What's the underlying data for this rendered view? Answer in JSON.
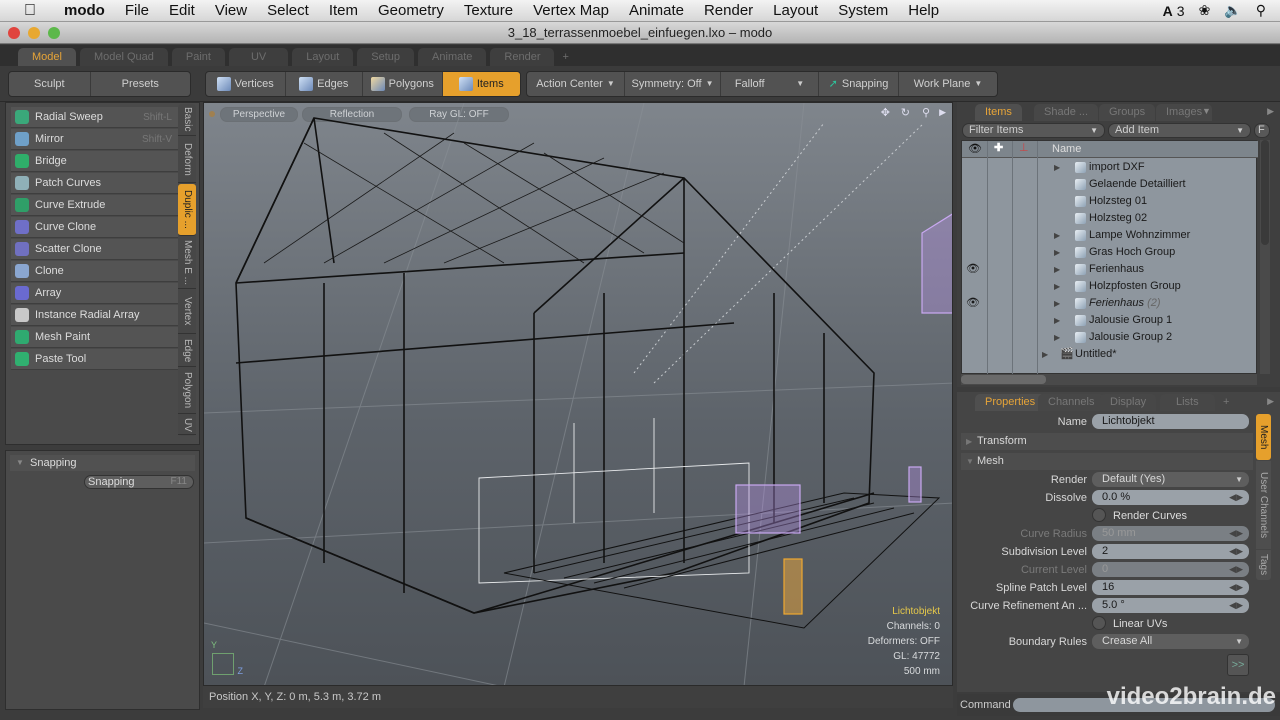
{
  "menubar": {
    "app": "modo",
    "items": [
      "File",
      "Edit",
      "View",
      "Select",
      "Item",
      "Geometry",
      "Texture",
      "Vertex Map",
      "Animate",
      "Render",
      "Layout",
      "System",
      "Help"
    ],
    "status_badge": "3"
  },
  "window": {
    "title": "3_18_terrassenmoebel_einfuegen.lxo – modo"
  },
  "layout_tabs": [
    "Model",
    "Model Quad",
    "Paint",
    "UV",
    "Layout",
    "Setup",
    "Animate",
    "Render",
    "+"
  ],
  "toolbar": {
    "sculpt": "Sculpt",
    "presets": "Presets",
    "modes": [
      "Vertices",
      "Edges",
      "Polygons",
      "Items"
    ],
    "action_center": "Action Center",
    "symmetry": "Symmetry: Off",
    "falloff": "Falloff",
    "snapping": "Snapping",
    "work_plane": "Work Plane"
  },
  "tools": [
    {
      "label": "Radial Sweep",
      "shortcut": "Shift-L",
      "color": "#3aa87a"
    },
    {
      "label": "Mirror",
      "shortcut": "Shift-V",
      "color": "#6fa0c8"
    },
    {
      "label": "Bridge",
      "shortcut": "",
      "color": "#2fae6a"
    },
    {
      "label": "Patch Curves",
      "shortcut": "",
      "color": "#8fb0b8"
    },
    {
      "label": "Curve Extrude",
      "shortcut": "",
      "color": "#2f9f68"
    },
    {
      "label": "Curve Clone",
      "shortcut": "",
      "color": "#6f6fc8"
    },
    {
      "label": "Scatter Clone",
      "shortcut": "",
      "color": "#7070c0"
    },
    {
      "label": "Clone",
      "shortcut": "",
      "color": "#8aa6d0"
    },
    {
      "label": "Array",
      "shortcut": "",
      "color": "#6a6ad0"
    },
    {
      "label": "Instance Radial Array",
      "shortcut": "",
      "color": "#c8c8c8"
    },
    {
      "label": "Mesh Paint",
      "shortcut": "",
      "color": "#2faa70"
    },
    {
      "label": "Paste Tool",
      "shortcut": "",
      "color": "#30b070"
    }
  ],
  "tool_tabs": [
    "Basic",
    "Deform",
    "Duplic ...",
    "Mesh E ...",
    "Vertex",
    "Edge",
    "Polygon",
    "UV"
  ],
  "snapping_panel": {
    "header": "Snapping",
    "button": "Snapping",
    "shortcut": "F11"
  },
  "viewport": {
    "buttons": [
      "Perspective",
      "Reflection",
      "Ray GL: OFF"
    ],
    "info": {
      "selected": "Lichtobjekt",
      "channels": "Channels: 0",
      "deformers": "Deformers: OFF",
      "gl": "GL: 47772",
      "scale": "500 mm"
    },
    "axis": {
      "y": "Y",
      "z": "Z"
    }
  },
  "status": {
    "position": "Position X, Y, Z:   0 m, 5.3 m, 3.72 m"
  },
  "items_panel": {
    "tabs": [
      "Items",
      "Shade ...",
      "Groups",
      "Images"
    ],
    "filter": "Filter Items",
    "add_item": "Add Item",
    "f_button": "F",
    "name_header": "Name",
    "rows": [
      {
        "label": "import DXF",
        "arrow": true,
        "eye": false,
        "italic": false
      },
      {
        "label": "Gelaende Detailliert",
        "arrow": false,
        "eye": false,
        "italic": false
      },
      {
        "label": "Holzsteg 01",
        "arrow": false,
        "eye": false,
        "italic": false
      },
      {
        "label": "Holzsteg 02",
        "arrow": false,
        "eye": false,
        "italic": false
      },
      {
        "label": "Lampe Wohnzimmer",
        "arrow": true,
        "eye": false,
        "italic": false
      },
      {
        "label": "Gras Hoch Group",
        "arrow": true,
        "eye": false,
        "italic": false
      },
      {
        "label": "Ferienhaus",
        "arrow": true,
        "eye": true,
        "italic": false
      },
      {
        "label": "Holzpfosten Group",
        "arrow": true,
        "eye": false,
        "italic": false
      },
      {
        "label": "Ferienhaus",
        "suffix": "(2)",
        "arrow": true,
        "eye": true,
        "italic": true
      },
      {
        "label": "Jalousie Group 1",
        "arrow": true,
        "eye": false,
        "italic": false
      },
      {
        "label": "Jalousie Group 2",
        "arrow": true,
        "eye": false,
        "italic": false
      }
    ],
    "scene": "Untitled*"
  },
  "properties": {
    "tabs": [
      "Properties",
      "Channels",
      "Display",
      "Lists",
      "+"
    ],
    "side_tabs": [
      "Mesh",
      "User Channels",
      "Tags"
    ],
    "name_label": "Name",
    "name_value": "Lichtobjekt",
    "transform": "Transform",
    "mesh": "Mesh",
    "render_label": "Render",
    "render_value": "Default (Yes)",
    "dissolve_label": "Dissolve",
    "dissolve_value": "0.0 %",
    "render_curves": "Render Curves",
    "curve_radius_label": "Curve Radius",
    "curve_radius_value": "50 mm",
    "subdiv_label": "Subdivision Level",
    "subdiv_value": "2",
    "current_label": "Current Level",
    "current_value": "0",
    "spline_label": "Spline Patch Level",
    "spline_value": "16",
    "refine_label": "Curve Refinement An ...",
    "refine_value": "5.0 °",
    "linear_uvs": "Linear UVs",
    "boundary_label": "Boundary Rules",
    "boundary_value": "Crease All",
    "more": ">>"
  },
  "command": {
    "label": "Command",
    "value": ""
  },
  "watermark": "video2brain.de"
}
